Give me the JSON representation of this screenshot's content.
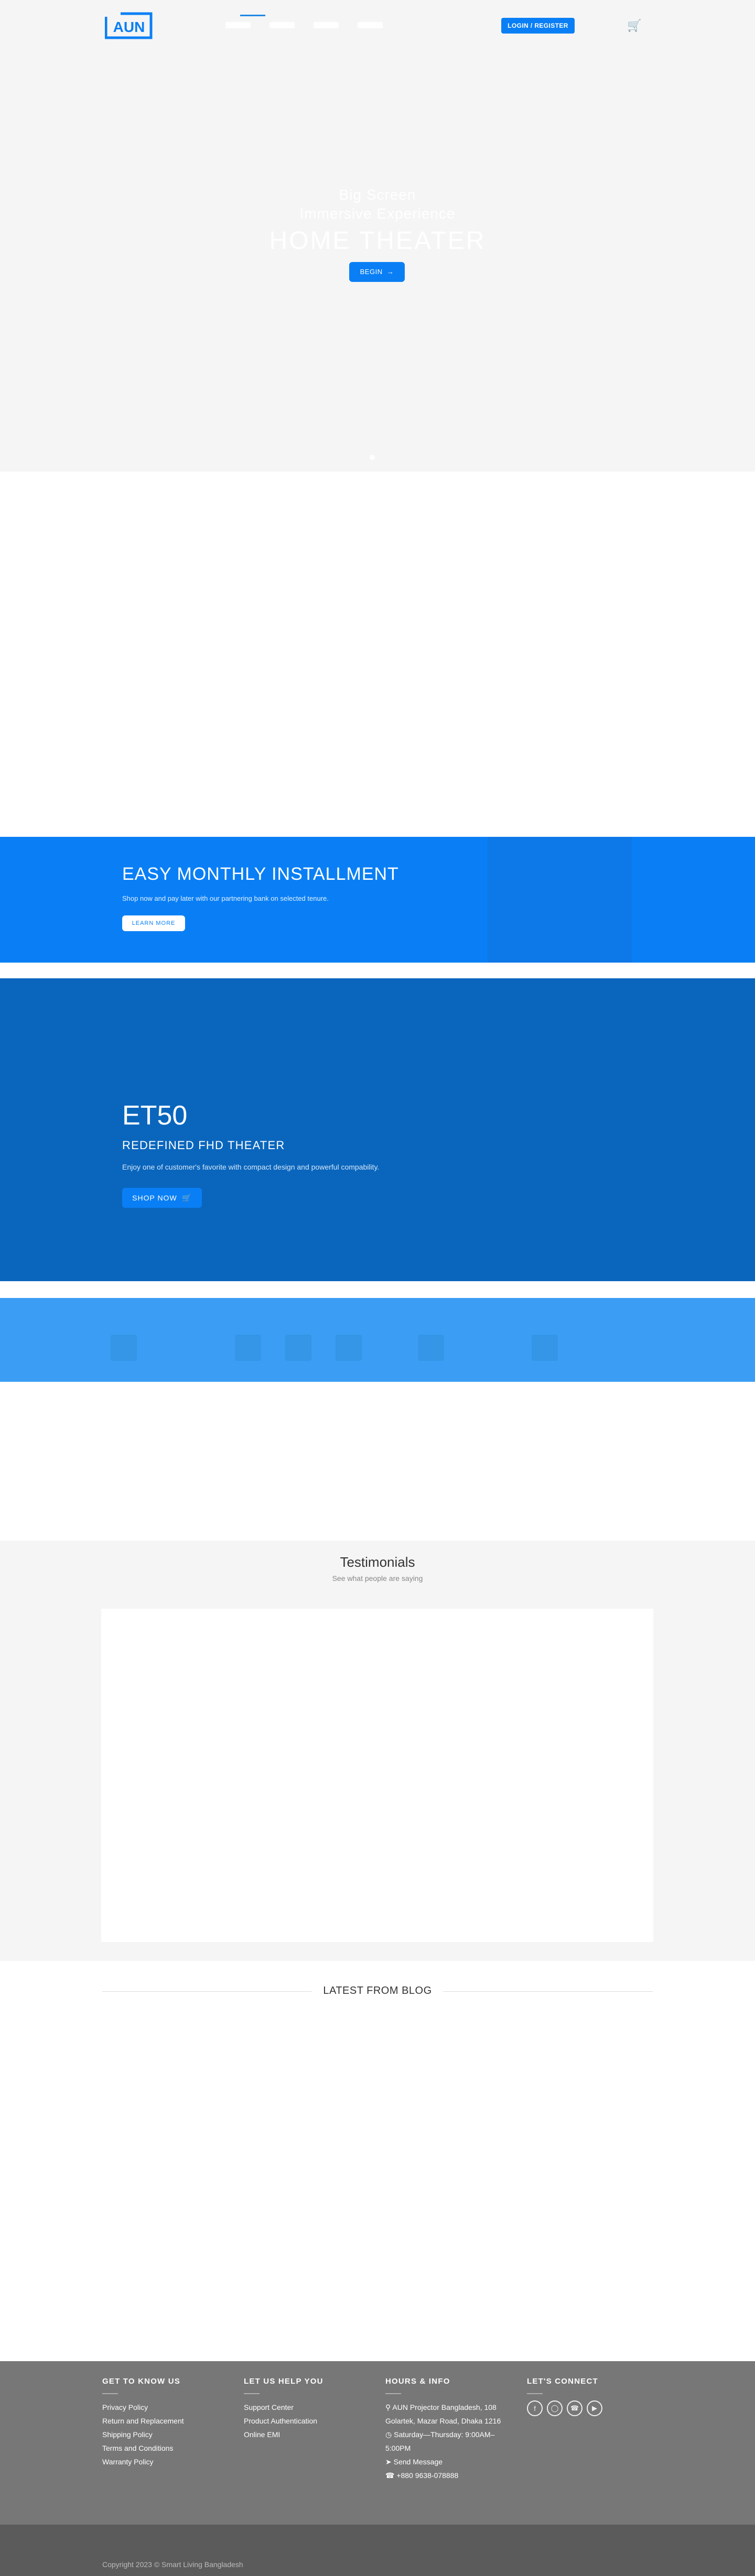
{
  "header": {
    "logo_text": "AUN",
    "login_label": "LOGIN / REGISTER"
  },
  "hero": {
    "line1": "Big Screen",
    "line2": "Immersive Experience",
    "title": "HOME THEATER",
    "button_label": "BEGIN"
  },
  "installment": {
    "title": "EASY MONTHLY INSTALLMENT",
    "subtitle": "Shop now and pay later with our partnering bank on selected tenure.",
    "button_label": "LEARN MORE"
  },
  "et50": {
    "title": "ET50",
    "subtitle": "REDEFINED FHD THEATER",
    "description": "Enjoy one of customer's favorite with compact design and powerful compability.",
    "button_label": "SHOP NOW"
  },
  "testimonials": {
    "title": "Testimonials",
    "subtitle": "See what people are saying"
  },
  "blog": {
    "title": "LATEST FROM BLOG"
  },
  "footer": {
    "col1": {
      "heading": "GET TO KNOW US",
      "links": [
        "Privacy Policy",
        "Return and Replacement",
        "Shipping Policy",
        "Terms and Conditions",
        "Warranty Policy"
      ]
    },
    "col2": {
      "heading": "LET US HELP YOU",
      "links": [
        "Support Center",
        "Product Authentication",
        "Online EMI"
      ]
    },
    "col3": {
      "heading": "HOURS & INFO",
      "address": "AUN Projector Bangladesh, 108 Golartek, Mazar Road, Dhaka 1216",
      "hours": "Saturday—Thursday: 9:00AM–5:00PM",
      "message": "Send Message",
      "phone": "+880 9638-078888"
    },
    "col4": {
      "heading": "LET'S CONNECT",
      "icons": [
        "facebook-icon",
        "instagram-icon",
        "phone-icon",
        "youtube-icon"
      ]
    },
    "copyright": "Copyright 2023 © Smart Living Bangladesh"
  },
  "colors": {
    "accent": "#0a7ff5",
    "et50_bg": "#0a66bd",
    "strip_bg": "#3b9ef4",
    "footer_bg": "#777777",
    "copy_bg": "#5b5b5b"
  }
}
